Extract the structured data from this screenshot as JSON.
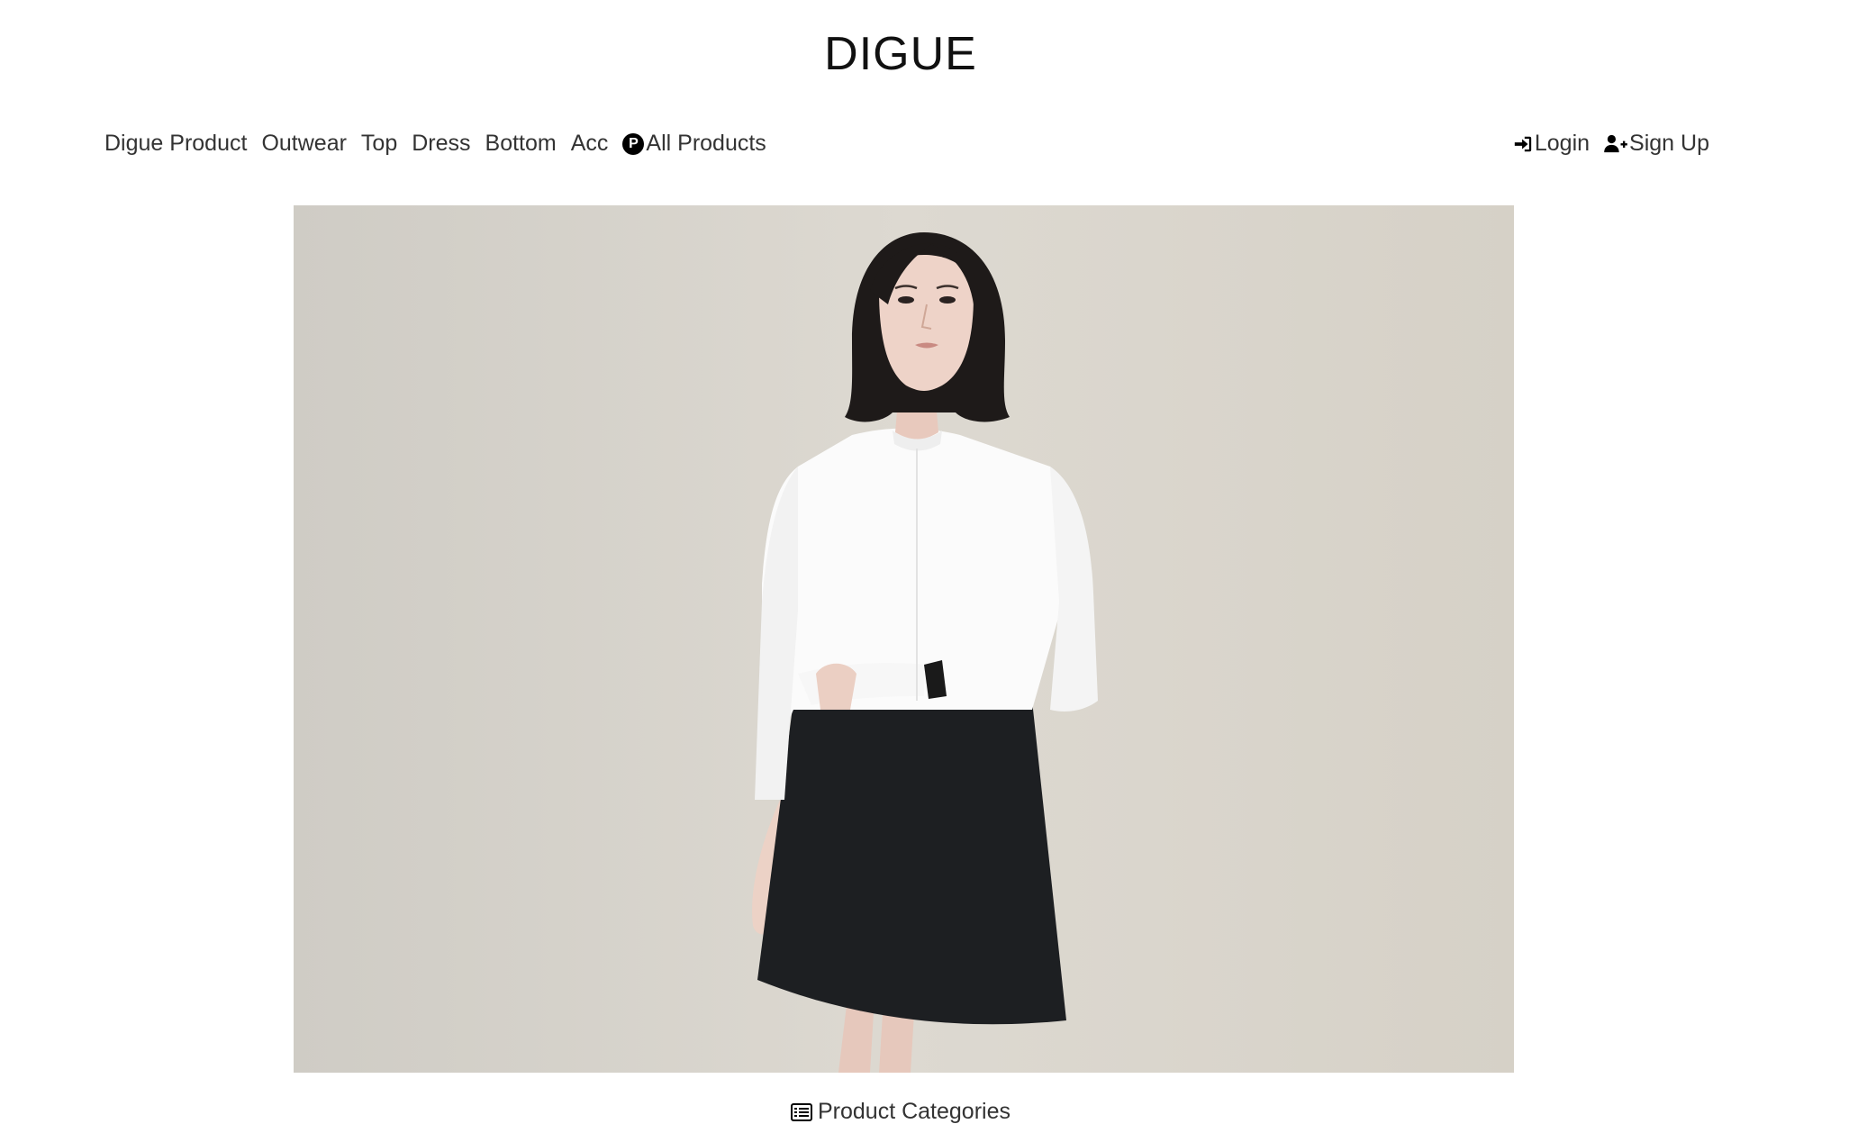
{
  "header": {
    "brand": "DIGUE"
  },
  "nav": {
    "items": [
      {
        "label": "Digue Product"
      },
      {
        "label": "Outwear"
      },
      {
        "label": "Top"
      },
      {
        "label": "Dress"
      },
      {
        "label": "Bottom"
      },
      {
        "label": "Acc"
      }
    ],
    "all_products": {
      "badge": "P",
      "label": "All Products"
    }
  },
  "auth": {
    "login_label": "Login",
    "signup_label": "Sign Up"
  },
  "footer": {
    "categories_label": "Product Categories"
  },
  "colors": {
    "text": "#333333",
    "brand": "#111111",
    "icon": "#000000",
    "background": "#ffffff"
  },
  "icons": {
    "login": "sign-in-icon",
    "signup": "user-plus-icon",
    "categories": "list-alt-icon",
    "all_products": "p-circle-icon"
  }
}
